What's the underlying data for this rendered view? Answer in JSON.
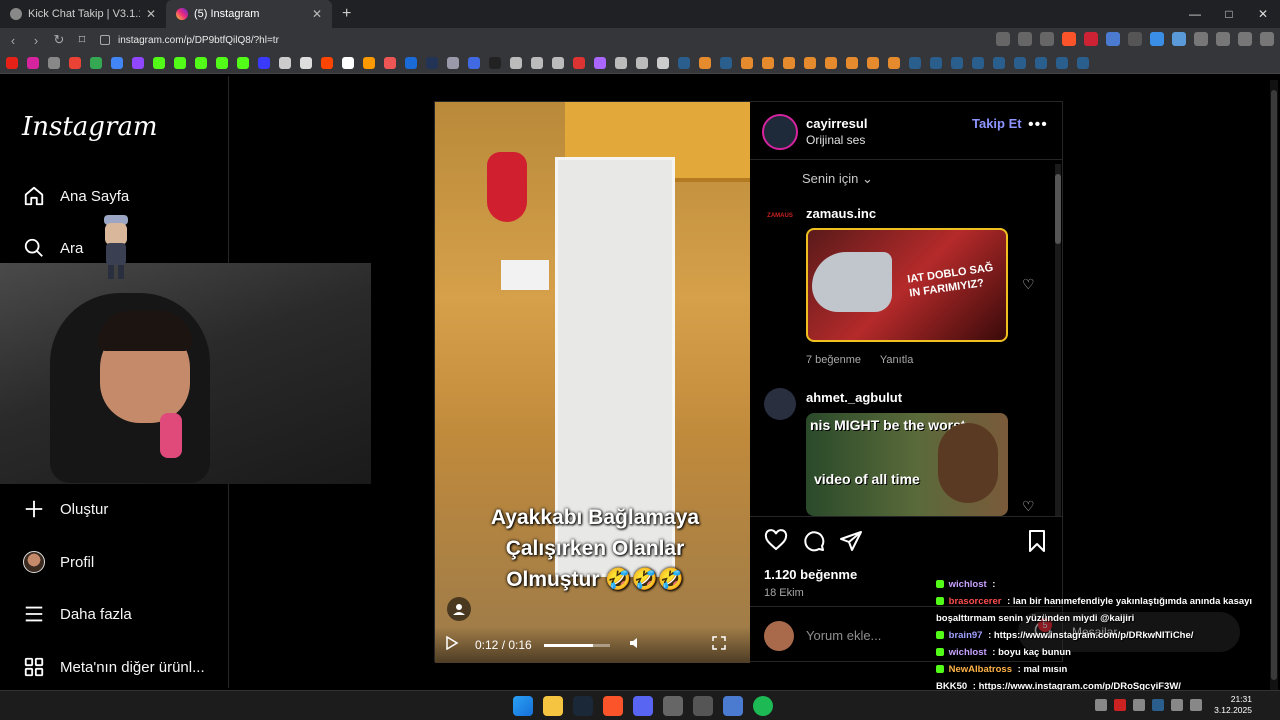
{
  "browser": {
    "tabs": [
      {
        "label": "Kick Chat Takip | V3.1.1",
        "active": false
      },
      {
        "label": "(5) Instagram",
        "active": true
      }
    ],
    "new_tab": "+",
    "url": "instagram.com/p/DP9btfQilQ8/?hl=tr",
    "window_controls": [
      "—",
      "□",
      "✕"
    ]
  },
  "sidebar": {
    "logo": "Instagram",
    "items": [
      {
        "label": "Ana Sayfa",
        "icon": "home-icon"
      },
      {
        "label": "Ara",
        "icon": "search-icon"
      },
      {
        "label": "Oluştur",
        "icon": "plus-icon"
      },
      {
        "label": "Profil",
        "icon": "profile-avatar"
      },
      {
        "label": "Daha fazla",
        "icon": "menu-icon"
      },
      {
        "label": "Meta'nın diğer ürünl...",
        "icon": "grid-icon"
      }
    ]
  },
  "post": {
    "username": "cayirresul",
    "audio": "Orijinal ses",
    "follow_label": "Takip Et",
    "more": "•••",
    "video": {
      "caption_lines": [
        "Ayakkabı Bağlamaya",
        "Çalışırken Olanlar",
        "Olmuştur 🤣🤣🤣"
      ],
      "time": "0:12 / 0:16",
      "progress": 0.75
    },
    "sort_label": "Senin için",
    "comments": [
      {
        "user": "zamaus.inc",
        "avatar_text": "ZAMAUS",
        "image_text": "IAT DOBLO SAĞ IN FARIMIYIZ?",
        "likes": "7 beğenme",
        "reply": "Yanıtla"
      },
      {
        "user": "ahmet._agbulut",
        "image_text_1": "nis MIGHT be the worst",
        "image_text_2": "video of all time"
      }
    ],
    "like_count": "1.120 beğenme",
    "date": "18 Ekim",
    "comment_placeholder": "Yorum ekle..."
  },
  "chat": [
    {
      "user": "wichlost",
      "text": ":",
      "color": "#c8a2ff"
    },
    {
      "user": "brasorcerer",
      "text": ": lan bir hanımefendiyle yakınlaştığımda anında kasayı boşalttırmam senin yüzünden miydi @kaijiri",
      "color": "#ff4d4d"
    },
    {
      "user": "brain97",
      "text": ": https://www.instagram.com/p/DRkwNITiChe/",
      "color": "#a0a0ff"
    },
    {
      "user": "wichlost",
      "text": ": boyu kaç bunun",
      "color": "#c8a2ff"
    },
    {
      "user": "NewAlbatross",
      "text": ": mal mısın",
      "color": "#ffb347"
    },
    {
      "user": "BKK50",
      "text": ": https://www.instagram.com/p/DRoSgcyiF3W/",
      "color": "#ffffff"
    }
  ],
  "messages_pill": {
    "label": "Mesajlar",
    "count": "5"
  },
  "taskbar": {
    "time": "21:31",
    "date": "3.12.2025"
  },
  "colors": {
    "background": "#000000",
    "accent": "#8c94ff",
    "border": "#262626"
  }
}
